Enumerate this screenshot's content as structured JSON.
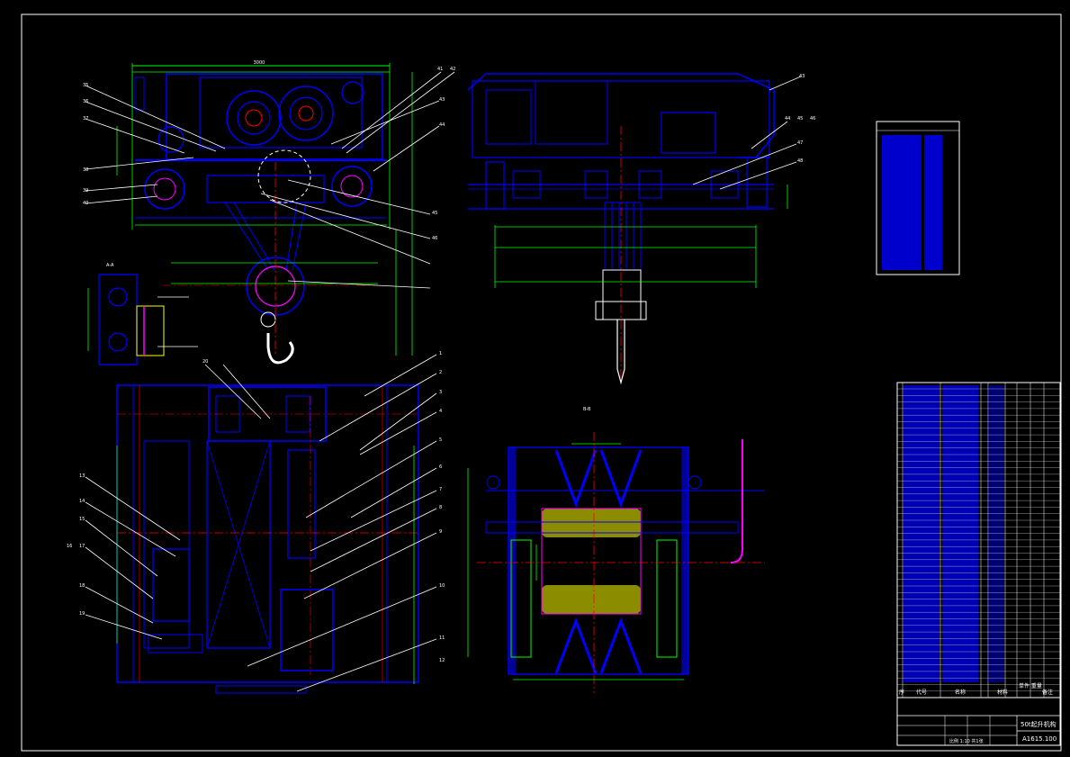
{
  "title_block": {
    "header_row": [
      "序",
      "代号",
      "名称",
      "材料",
      "单件 重量",
      "备注"
    ],
    "drawing_name": "50t起升机构",
    "drawing_number": "A1615.100",
    "scale_row": "比例 1:10 共1张"
  },
  "views": {
    "side_view_label": "",
    "detail_label": "A-A",
    "sheave_label": "B-B"
  },
  "balloons_left": [
    "35",
    "36",
    "37",
    "38",
    "39",
    "40",
    "41",
    "42",
    "43",
    "44",
    "45",
    "46"
  ],
  "balloons_right_top": [
    "43",
    "44",
    "45",
    "46",
    "47",
    "48"
  ],
  "balloons_plan": [
    "1",
    "2",
    "3",
    "4",
    "5",
    "6",
    "7",
    "8",
    "9",
    "10",
    "11",
    "12",
    "13",
    "14",
    "15",
    "16",
    "17",
    "18",
    "19",
    "20"
  ],
  "colors": {
    "background": "#000000",
    "outline": "#0000ff",
    "dimension": "#00ff00",
    "centerline": "#ff0000",
    "leader": "#ffffff",
    "text": "#ffffff",
    "hatch_magenta": "#ff00ff",
    "hatch_yellow": "#ffff00"
  }
}
